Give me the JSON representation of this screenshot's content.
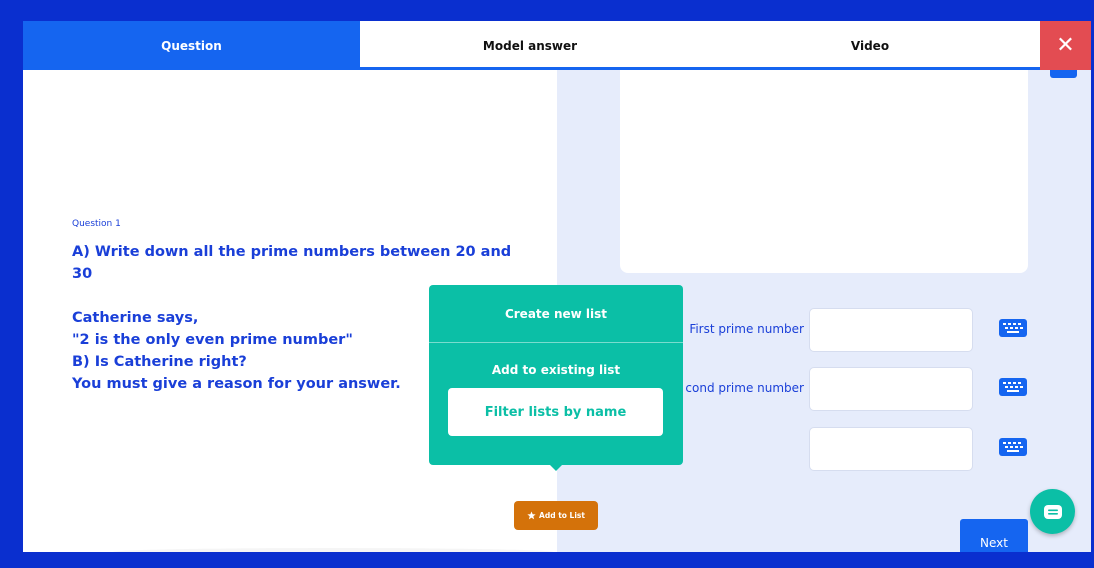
{
  "tabs": {
    "question": "Question",
    "model_answer": "Model answer",
    "video": "Video",
    "close": "✕",
    "active": "Question"
  },
  "question": {
    "number": "Question 1",
    "part_a": "A) Write down all the prime numbers between 20 and\n30",
    "statement": "Catherine says,\n\"2 is the only even prime number\"\nB) Is Catherine right?\nYou must give a reason for your answer."
  },
  "answer": {
    "rows": [
      {
        "label": "First prime number",
        "value": ""
      },
      {
        "label": "cond prime number",
        "value": ""
      },
      {
        "label": "",
        "value": ""
      }
    ],
    "keyboard_icon": "keyboard-icon"
  },
  "popup": {
    "create_new": "Create new list",
    "add_existing": "Add to existing list",
    "filter_placeholder": "Filter lists by name"
  },
  "add_to_list": {
    "label": "Add to List",
    "icon": "star-icon"
  },
  "next": "Next",
  "colors": {
    "frame": "#0a2fcf",
    "accent": "#1565f0",
    "close": "#e34c52",
    "teal": "#0bbfa6",
    "orange": "#d4720a",
    "text_blue": "#1a3fd8"
  }
}
